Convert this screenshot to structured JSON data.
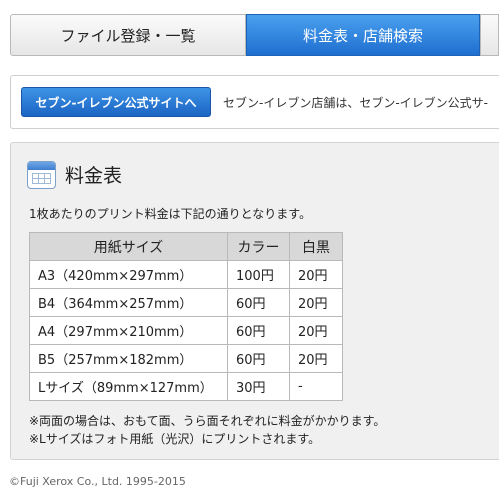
{
  "tabs": [
    {
      "label": "ファイル登録・一覧",
      "active": false
    },
    {
      "label": "料金表・店舗検索",
      "active": true
    }
  ],
  "promo": {
    "button_label": "セブン-イレブン公式サイトへ",
    "text": "セブン-イレブン店舗は、セブン-イレブン公式サ-"
  },
  "price_panel": {
    "icon": "calendar-table-icon",
    "title": "料金表",
    "description": "1枚あたりのプリント料金は下記の通りとなります。",
    "table": {
      "headers": [
        "用紙サイズ",
        "カラー",
        "白黒"
      ],
      "rows": [
        [
          "A3（420mm×297mm）",
          "100円",
          "20円"
        ],
        [
          "B4（364mm×257mm）",
          "60円",
          "20円"
        ],
        [
          "A4（297mm×210mm）",
          "60円",
          "20円"
        ],
        [
          "B5（257mm×182mm）",
          "60円",
          "20円"
        ],
        [
          "Lサイズ（89mm×127mm）",
          "30円",
          "-"
        ]
      ]
    },
    "notes": [
      "※両面の場合は、おもて面、うら面それぞれに料金がかかります。",
      "※Lサイズはフォト用紙（光沢）にプリントされます。"
    ]
  },
  "footer": {
    "copyright": "©Fuji Xerox Co., Ltd. 1995-2015"
  },
  "colors": {
    "active_tab": "#1f6fd0",
    "button": "#1b64c3",
    "panel_bg": "#f0f0f0",
    "table_header_bg": "#d8d8d8"
  }
}
